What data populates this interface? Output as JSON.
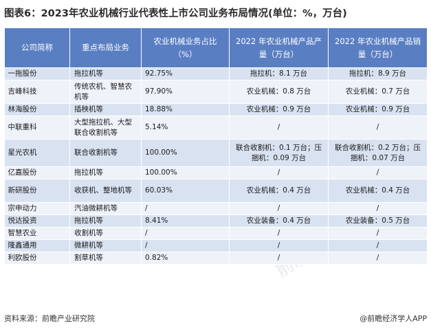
{
  "title": "图表6：2023年农业机械行业代表性上市公司业务布局情况(单位：%，万台)",
  "headers": [
    "公司简称",
    "重点布局业务",
    "农业机械业务占比（%）",
    "2022 年农业机械产品产量（万台）",
    "2022 年农业机械产品销量（万台）"
  ],
  "rows": [
    {
      "name": "一拖股份",
      "biz": "拖拉机等",
      "pct": "92.75%",
      "prod": "拖拉机：8.1 万台",
      "sale": "拖拉机：8.9 万台"
    },
    {
      "name": "吉峰科技",
      "biz": "传统农机、智慧农机等",
      "pct": "97.90%",
      "prod": "农业机械：0.8 万台",
      "sale": "农业机械：0.7 万台"
    },
    {
      "name": "林海股份",
      "biz": "插秧机等",
      "pct": "18.88%",
      "prod": "农业机械：0.9 万台",
      "sale": "农业机械：0.9 万台"
    },
    {
      "name": "中联重科",
      "biz": "大型拖拉机、大型联合收割机等",
      "pct": "5.14%",
      "prod": "/",
      "sale": "/"
    },
    {
      "name": "星光农机",
      "biz": "联合收割机等",
      "pct": "100.00%",
      "prod": "联合收割机：0.1 万台；压捆机：0.09 万台",
      "sale": "联合收割机：0.2 万台；压捆机：0.07 万台"
    },
    {
      "name": "亿嘉股份",
      "biz": "拖拉机等",
      "pct": "100.00%",
      "prod": "/",
      "sale": "/"
    },
    {
      "name": "新研股份",
      "biz": "收获机、整地机等",
      "pct": "60.03%",
      "prod": "农业机械：0.4 万台",
      "sale": "农业机械：0.4 万台"
    },
    {
      "name": "宗申动力",
      "biz": "汽油微耕机等",
      "pct": "/",
      "prod": "/",
      "sale": "/"
    },
    {
      "name": "悦达投资",
      "biz": "拖拉机等",
      "pct": "8.41%",
      "prod": "农业装备：0.4 万台",
      "sale": "农业装备：0.5 万台"
    },
    {
      "name": "智慧农业",
      "biz": "收割机等",
      "pct": "/",
      "prod": "/",
      "sale": "/"
    },
    {
      "name": "隆鑫通用",
      "biz": "微耕机等",
      "pct": "/",
      "prod": "/",
      "sale": "/"
    },
    {
      "name": "利欧股份",
      "biz": "割草机等",
      "pct": "0.82%",
      "prod": "/",
      "sale": "/"
    }
  ],
  "source": "资料来源：前瞻产业研究院",
  "brand": "@前瞻经济学人APP",
  "watermark": "前瞻产业研究院"
}
